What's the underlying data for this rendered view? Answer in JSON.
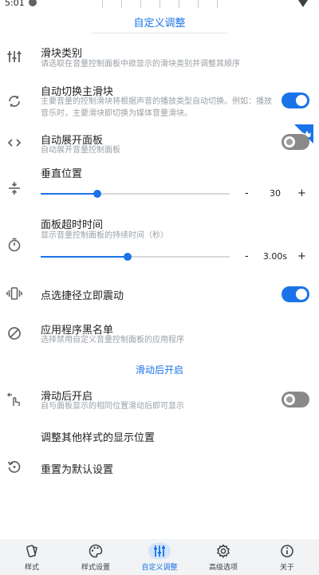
{
  "status_bar": {
    "time": "5:01"
  },
  "header": {
    "title": "自定义调整"
  },
  "settings": {
    "slider_type": {
      "title": "滑块类别",
      "desc": "请选取在音量控制面板中欲显示的滑块类别并调整其顺序"
    },
    "auto_switch": {
      "title": "自动切换主滑块",
      "desc": "主要音量的控制滑块将根据声音的播放类型自动切换。例如：播放音乐时，主要滑块即切换为媒体音量滑块。",
      "enabled": true
    },
    "auto_expand": {
      "title": "自动展开面板",
      "desc": "自动展开音量控制面板",
      "enabled": false,
      "premium": true
    },
    "vertical_position": {
      "title": "垂直位置",
      "value": "30",
      "level": 0.3,
      "minus": "-",
      "plus": "+"
    },
    "panel_timeout": {
      "title": "面板超时时间",
      "desc": "显示音量控制面板的持续时间（秒）",
      "value": "3.00s",
      "level": 0.46,
      "minus": "-",
      "plus": "+"
    },
    "haptic": {
      "title": "点选捷径立即震动",
      "enabled": true
    },
    "blacklist": {
      "title": "应用程序黑名单",
      "desc": "选择禁用自定义音量控制面板的应用程序"
    }
  },
  "swipe_section": {
    "header": "滑动后开启",
    "swipe_open": {
      "title": "滑动后开启",
      "desc": "自与面板显示的相同位置滑动后即可显示",
      "enabled": false
    },
    "adjust_other": {
      "title": "调整其他样式的显示位置"
    },
    "reset": {
      "title": "重置为默认设置"
    }
  },
  "bottom_nav": {
    "items": [
      {
        "label": "样式",
        "icon": "style-icon"
      },
      {
        "label": "样式设置",
        "icon": "palette-icon"
      },
      {
        "label": "自定义调整",
        "icon": "tune-icon",
        "active": true
      },
      {
        "label": "高级选项",
        "icon": "gear-icon"
      },
      {
        "label": "关于",
        "icon": "info-icon"
      }
    ]
  },
  "colors": {
    "accent": "#1a73e8",
    "toggle_off": "#898989",
    "nav_bg": "#f1f3f4",
    "desc_text": "#9aa0a6"
  }
}
